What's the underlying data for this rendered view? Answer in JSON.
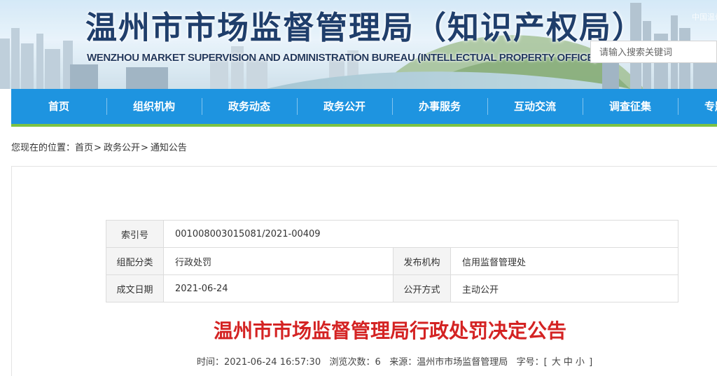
{
  "header": {
    "title": "温州市市场监督管理局（知识产权局）",
    "subtitle": "WENZHOU MARKET SUPERVISION AND ADMINISTRATION BUREAU (INTELLECTUAL PROPERTY OFFICE)",
    "corner_text": "中国温州",
    "search_placeholder": "请输入搜索关键词"
  },
  "nav": {
    "items": [
      {
        "label": "首页"
      },
      {
        "label": "组织机构"
      },
      {
        "label": "政务动态"
      },
      {
        "label": "政务公开"
      },
      {
        "label": "办事服务"
      },
      {
        "label": "互动交流"
      },
      {
        "label": "调查征集"
      },
      {
        "label": "专题专栏"
      }
    ]
  },
  "breadcrumb": {
    "prefix": "您现在的位置：",
    "items": [
      "首页",
      "政务公开",
      "通知公告"
    ],
    "separator": ">"
  },
  "meta": {
    "index_label": "索引号",
    "index_value": "001008003015081/2021-00409",
    "category_label": "组配分类",
    "category_value": "行政处罚",
    "publisher_label": "发布机构",
    "publisher_value": "信用监督管理处",
    "date_label": "成文日期",
    "date_value": "2021-06-24",
    "disclosure_label": "公开方式",
    "disclosure_value": "主动公开"
  },
  "article": {
    "title": "温州市市场监督管理局行政处罚决定公告",
    "time_label": "时间：",
    "time_value": "2021-06-24 16:57:30",
    "views_label": "浏览次数：",
    "views_value": "6",
    "source_label": "来源：",
    "source_value": "温州市市场监督管理局",
    "fontsize_label": "字号：",
    "fontsize_open": "[",
    "fontsize_large": "大",
    "fontsize_medium": "中",
    "fontsize_small": "小",
    "fontsize_close": "]"
  },
  "colors": {
    "nav_bg": "#1e94e0",
    "nav_accent": "#7cc243",
    "title_red": "#d42323",
    "header_text": "#1f3e6b"
  }
}
